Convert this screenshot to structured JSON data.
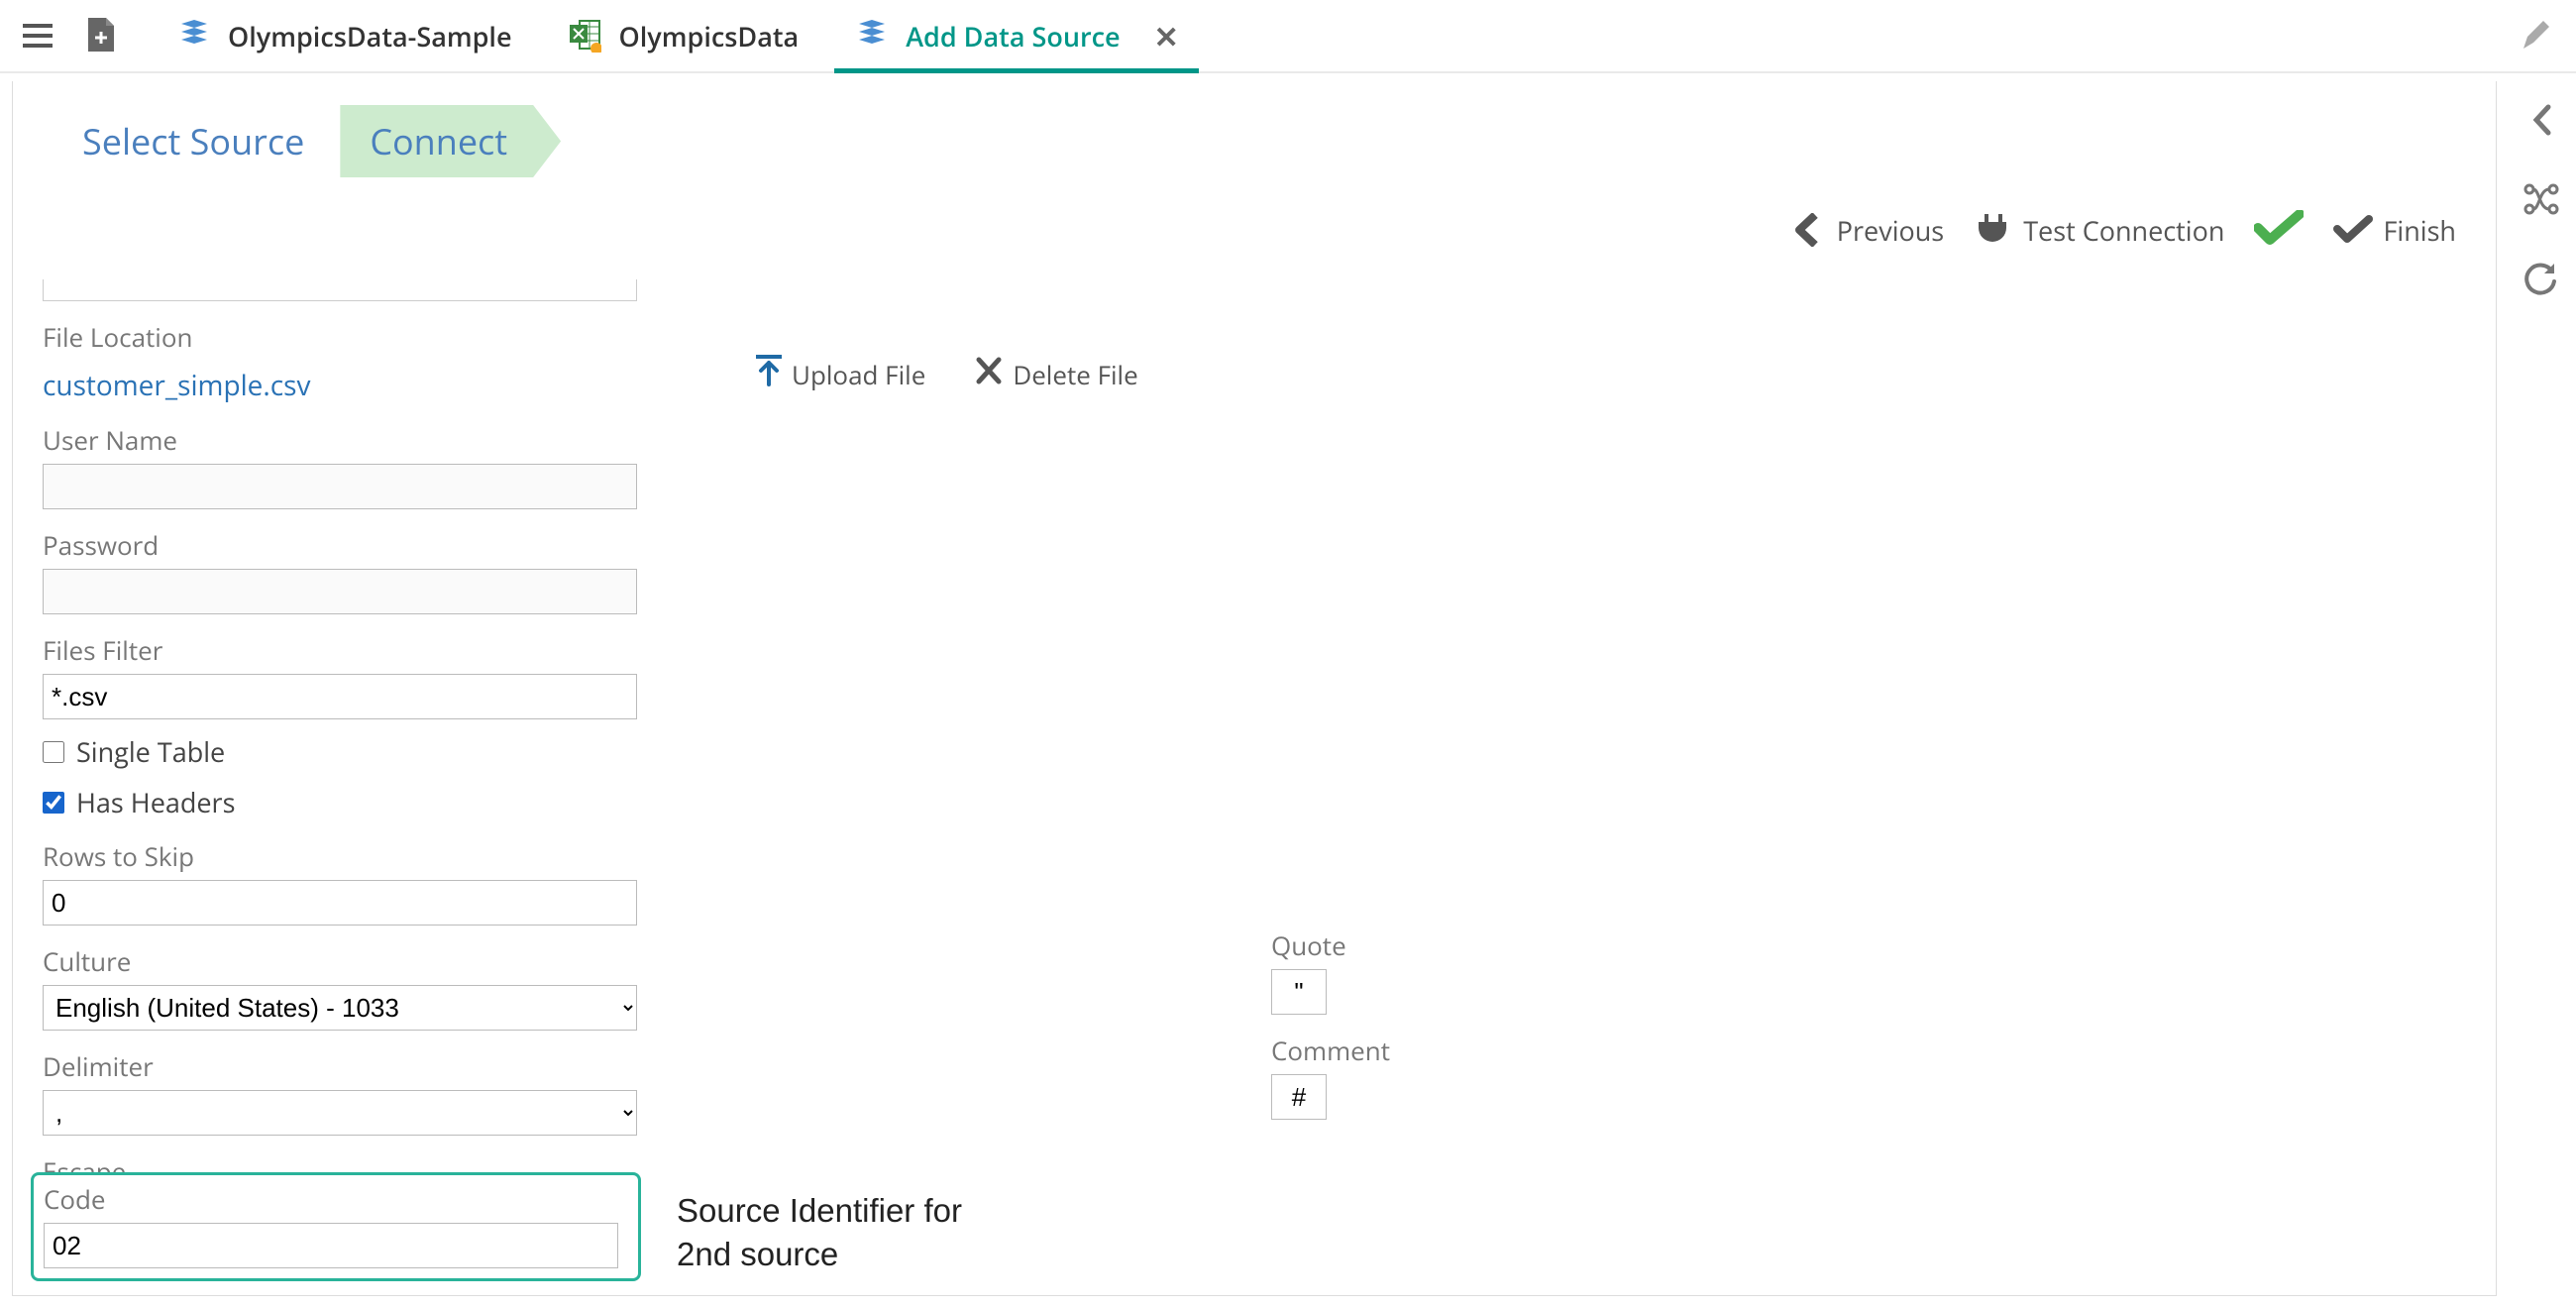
{
  "tabs": {
    "t0": "OlympicsData-Sample",
    "t1": "OlympicsData",
    "t2": "Add Data Source"
  },
  "wizard": {
    "step1": "Select Source",
    "step2": "Connect"
  },
  "actions": {
    "previous": "Previous",
    "test": "Test Connection",
    "finish": "Finish"
  },
  "form": {
    "file_location_label": "File Location",
    "file_location_value": "customer_simple.csv",
    "upload_file": "Upload File",
    "delete_file": "Delete File",
    "user_name_label": "User Name",
    "user_name_value": "",
    "password_label": "Password",
    "password_value": "",
    "files_filter_label": "Files Filter",
    "files_filter_value": "*.csv",
    "single_table_label": "Single Table",
    "single_table_checked": false,
    "has_headers_label": "Has Headers",
    "has_headers_checked": true,
    "rows_to_skip_label": "Rows to Skip",
    "rows_to_skip_value": "0",
    "culture_label": "Culture",
    "culture_value": "English (United States) - 1033",
    "delimiter_label": "Delimiter",
    "delimiter_value": ",",
    "quote_label": "Quote",
    "quote_value": "\"",
    "escape_label": "Escape",
    "escape_value": "\"",
    "comment_label": "Comment",
    "comment_value": "#",
    "code_label": "Code",
    "code_value": "02"
  },
  "annotation": {
    "line1": "Source Identifier for",
    "line2": "2nd source"
  }
}
